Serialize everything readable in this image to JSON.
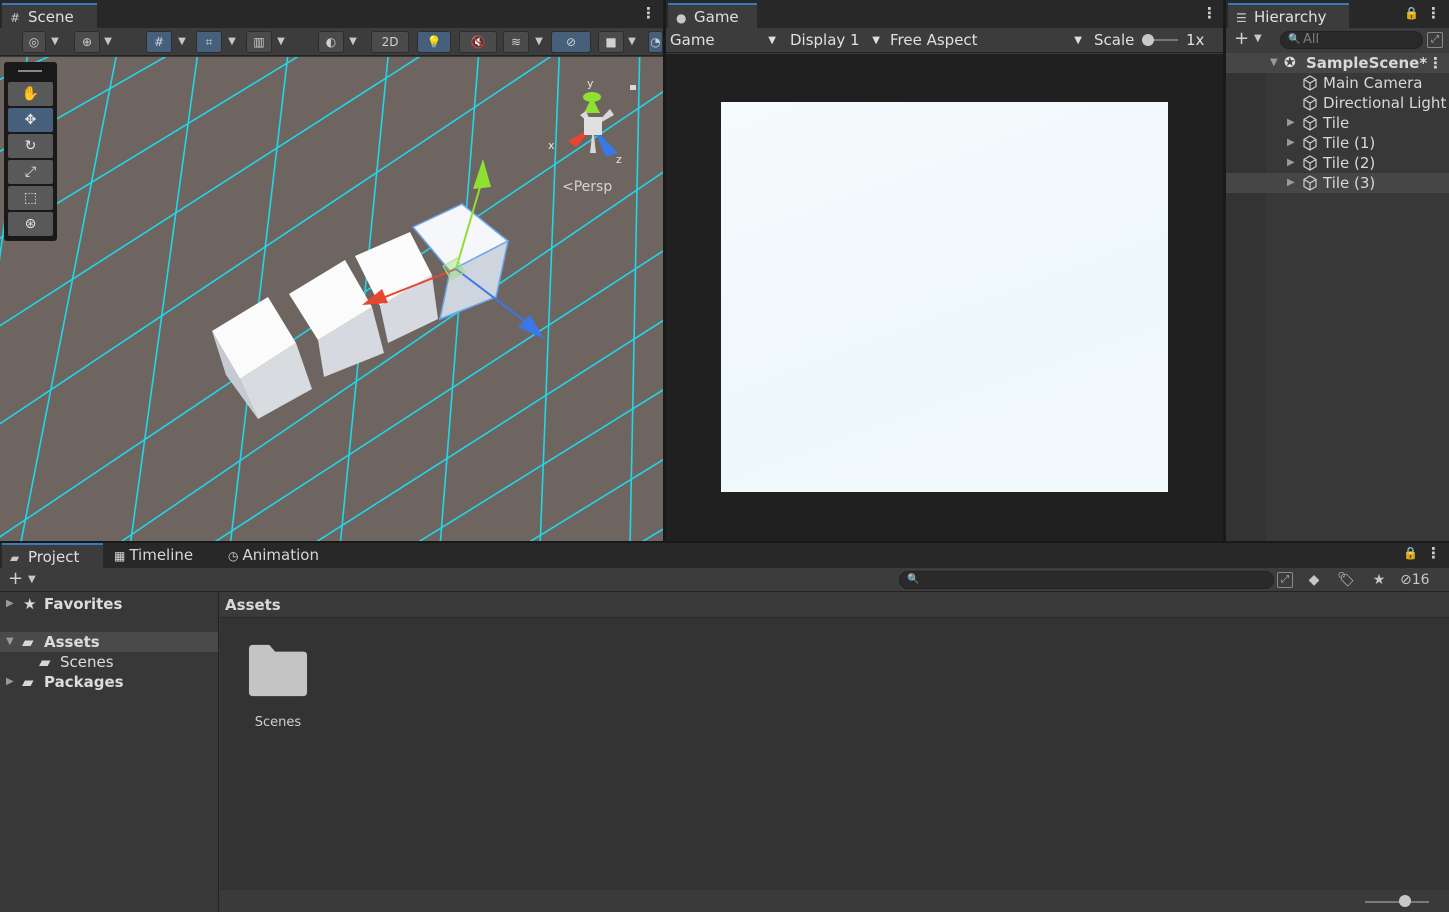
{
  "scene": {
    "tab_label": "Scene",
    "toolbar": {
      "mode_2d": "2D"
    },
    "gizmo": {
      "axis_x": "x",
      "axis_y": "y",
      "axis_z": "z",
      "projection": "Persp"
    }
  },
  "game": {
    "tab_label": "Game",
    "view_select": "Game",
    "display_select": "Display 1",
    "aspect_select": "Free Aspect",
    "scale_label": "Scale",
    "scale_value": "1x"
  },
  "hierarchy": {
    "tab_label": "Hierarchy",
    "search_placeholder": "All",
    "scene_name": "SampleScene*",
    "items": [
      {
        "label": "Main Camera"
      },
      {
        "label": "Directional Light"
      },
      {
        "label": "Tile"
      },
      {
        "label": "Tile (1)"
      },
      {
        "label": "Tile (2)"
      },
      {
        "label": "Tile (3)"
      }
    ]
  },
  "project": {
    "tabs": [
      {
        "label": "Project"
      },
      {
        "label": "Timeline"
      },
      {
        "label": "Animation"
      }
    ],
    "hidden_count": "16",
    "tree": {
      "favorites": "Favorites",
      "assets": "Assets",
      "scenes": "Scenes",
      "packages": "Packages"
    },
    "breadcrumb": "Assets",
    "assets": [
      {
        "label": "Scenes"
      }
    ]
  },
  "colors": {
    "accent": "#3a79bb",
    "grid_line": "#1fd6ea",
    "ground": "#6e6560",
    "axis_x": "#e8462e",
    "axis_y": "#8fe033",
    "axis_z": "#3a78e8"
  }
}
